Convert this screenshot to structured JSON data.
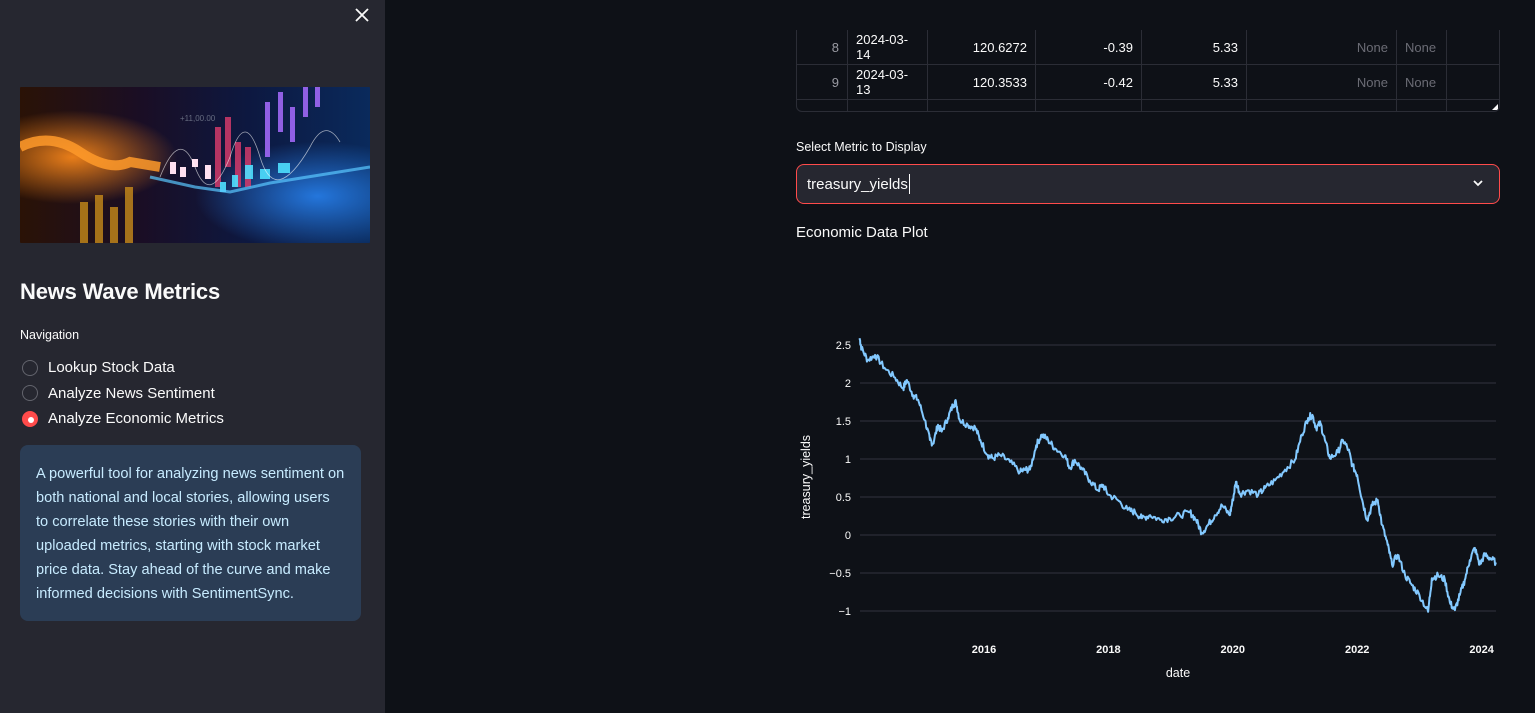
{
  "sidebar": {
    "close_icon": "close-icon",
    "hero_image": "financial-chart-image",
    "app_title": "News Wave Metrics",
    "navigation_label": "Navigation",
    "nav_options": [
      {
        "label": "Lookup Stock Data",
        "selected": false
      },
      {
        "label": "Analyze News Sentiment",
        "selected": false
      },
      {
        "label": "Analyze Economic Metrics",
        "selected": true
      }
    ],
    "info_text": "A powerful tool for analyzing news sentiment on both national and local stories, allowing users to correlate these stories with their own uploaded metrics, starting with stock market price data. Stay ahead of the curve and make informed decisions with SentimentSync.",
    "accent_color": "#ff4b4b"
  },
  "table": {
    "rows": [
      {
        "index": "8",
        "date": "2024-03-14",
        "c1": "120.6272",
        "c2": "-0.39",
        "c3": "5.33",
        "c4": "None",
        "c5": "None",
        "c6": ""
      },
      {
        "index": "9",
        "date": "2024-03-13",
        "c1": "120.3533",
        "c2": "-0.42",
        "c3": "5.33",
        "c4": "None",
        "c5": "None",
        "c6": ""
      }
    ]
  },
  "metric_select": {
    "label": "Select Metric to Display",
    "value": "treasury_yields"
  },
  "plot": {
    "title": "Economic Data Plot"
  },
  "chart_data": {
    "type": "line",
    "title": "",
    "xlabel": "date",
    "ylabel": "treasury_yields",
    "xlim": [
      2013.95,
      2024.25
    ],
    "ylim": [
      -1.22,
      2.65
    ],
    "grid": true,
    "legend": "none",
    "line_color": "#83c9ff",
    "x_ticks": [
      2016,
      2018,
      2020,
      2022,
      2024
    ],
    "x_tick_labels": [
      "2016",
      "2018",
      "2020",
      "2022",
      "2024"
    ],
    "y_ticks": [
      2.5,
      2,
      1.5,
      1,
      0.5,
      0,
      -0.5,
      -1
    ],
    "y_tick_labels": [
      "2.5",
      "2",
      "1.5",
      "1",
      "0.5",
      "0",
      "−0.5",
      "−1"
    ],
    "series": [
      {
        "name": "treasury_yields",
        "x": [
          2014.0,
          2014.03,
          2014.13,
          2014.25,
          2014.4,
          2014.57,
          2014.7,
          2014.76,
          2014.86,
          2014.94,
          2015.05,
          2015.13,
          2015.18,
          2015.26,
          2015.32,
          2015.42,
          2015.5,
          2015.55,
          2015.61,
          2015.74,
          2015.86,
          2015.94,
          2016.06,
          2016.14,
          2016.26,
          2016.42,
          2016.58,
          2016.66,
          2016.74,
          2016.84,
          2016.93,
          2017.03,
          2017.14,
          2017.3,
          2017.38,
          2017.46,
          2017.58,
          2017.7,
          2017.83,
          2017.91,
          2018.0,
          2018.15,
          2018.31,
          2018.43,
          2018.54,
          2018.67,
          2018.83,
          2018.99,
          2019.15,
          2019.31,
          2019.41,
          2019.5,
          2019.6,
          2019.71,
          2019.83,
          2019.95,
          2020.0,
          2020.05,
          2020.12,
          2020.24,
          2020.41,
          2020.52,
          2020.68,
          2020.84,
          2021.0,
          2021.11,
          2021.21,
          2021.28,
          2021.34,
          2021.41,
          2021.48,
          2021.56,
          2021.69,
          2021.77,
          2021.86,
          2021.92,
          2022.0,
          2022.08,
          2022.16,
          2022.24,
          2022.33,
          2022.4,
          2022.49,
          2022.56,
          2022.65,
          2022.77,
          2022.88,
          2023.0,
          2023.14,
          2023.2,
          2023.3,
          2023.41,
          2023.49,
          2023.57,
          2023.65,
          2023.73,
          2023.81,
          2023.89,
          2023.97,
          2024.05,
          2024.13,
          2024.23
        ],
        "y": [
          2.59,
          2.46,
          2.3,
          2.37,
          2.2,
          2.07,
          1.93,
          2.04,
          1.84,
          1.78,
          1.51,
          1.25,
          1.2,
          1.45,
          1.36,
          1.54,
          1.71,
          1.75,
          1.51,
          1.45,
          1.41,
          1.25,
          1.05,
          1.01,
          1.05,
          0.96,
          0.83,
          0.86,
          0.86,
          1.18,
          1.32,
          1.25,
          1.14,
          1.05,
          0.88,
          0.99,
          0.86,
          0.72,
          0.59,
          0.66,
          0.53,
          0.46,
          0.33,
          0.3,
          0.22,
          0.26,
          0.2,
          0.22,
          0.26,
          0.3,
          0.2,
          0.03,
          0.13,
          0.26,
          0.39,
          0.26,
          0.46,
          0.7,
          0.54,
          0.59,
          0.53,
          0.62,
          0.72,
          0.86,
          0.99,
          1.32,
          1.54,
          1.58,
          1.41,
          1.47,
          1.25,
          1.01,
          1.09,
          1.25,
          1.12,
          0.92,
          0.79,
          0.46,
          0.2,
          0.39,
          0.46,
          0.13,
          -0.13,
          -0.39,
          -0.26,
          -0.53,
          -0.66,
          -0.79,
          -1.01,
          -0.57,
          -0.53,
          -0.59,
          -0.89,
          -0.99,
          -0.79,
          -0.59,
          -0.33,
          -0.17,
          -0.39,
          -0.26,
          -0.3,
          -0.36
        ]
      }
    ]
  }
}
